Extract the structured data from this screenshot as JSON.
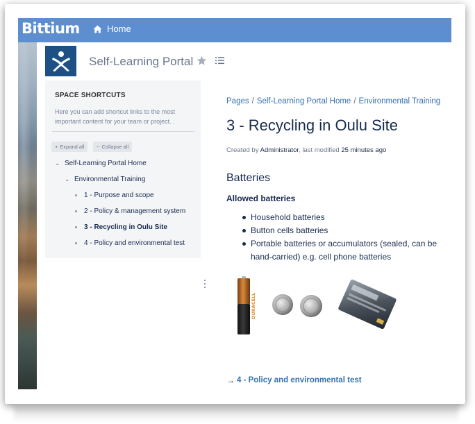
{
  "topbar": {
    "brand": "Bittium",
    "home_label": "Home"
  },
  "space": {
    "title": "Self-Learning Portal"
  },
  "sidebar": {
    "shortcuts_title": "SPACE SHORTCUTS",
    "shortcuts_desc": "Here you can add shortcut links to the most important content for your team or project. .",
    "expand_all": "Expand all",
    "collapse_all": "Collapse all",
    "tree": [
      {
        "label": "Self-Learning Portal Home"
      },
      {
        "label": "Environmental Training"
      },
      {
        "label": "1 - Purpose and scope"
      },
      {
        "label": "2 - Policy & management system"
      },
      {
        "label": "3 - Recycling in Oulu Site"
      },
      {
        "label": "4 - Policy and environmental test"
      }
    ]
  },
  "breadcrumb": [
    "Pages",
    "Self-Learning Portal Home",
    "Environmental Training"
  ],
  "page": {
    "title": "3 - Recycling in Oulu Site",
    "byline_created": "Created by",
    "byline_author": "Administrator",
    "byline_modified": ", last modified",
    "byline_time": "25 minutes ago",
    "section_heading": "Batteries",
    "subheading": "Allowed batteries",
    "items": [
      "Household batteries",
      "Button cells batteries",
      "Portable batteries or accumulators (sealed, can be hand-carried) e.g. cell phone batteries"
    ],
    "battery_brand": "DURACELL",
    "next_link": "4 - Policy and environmental test"
  }
}
